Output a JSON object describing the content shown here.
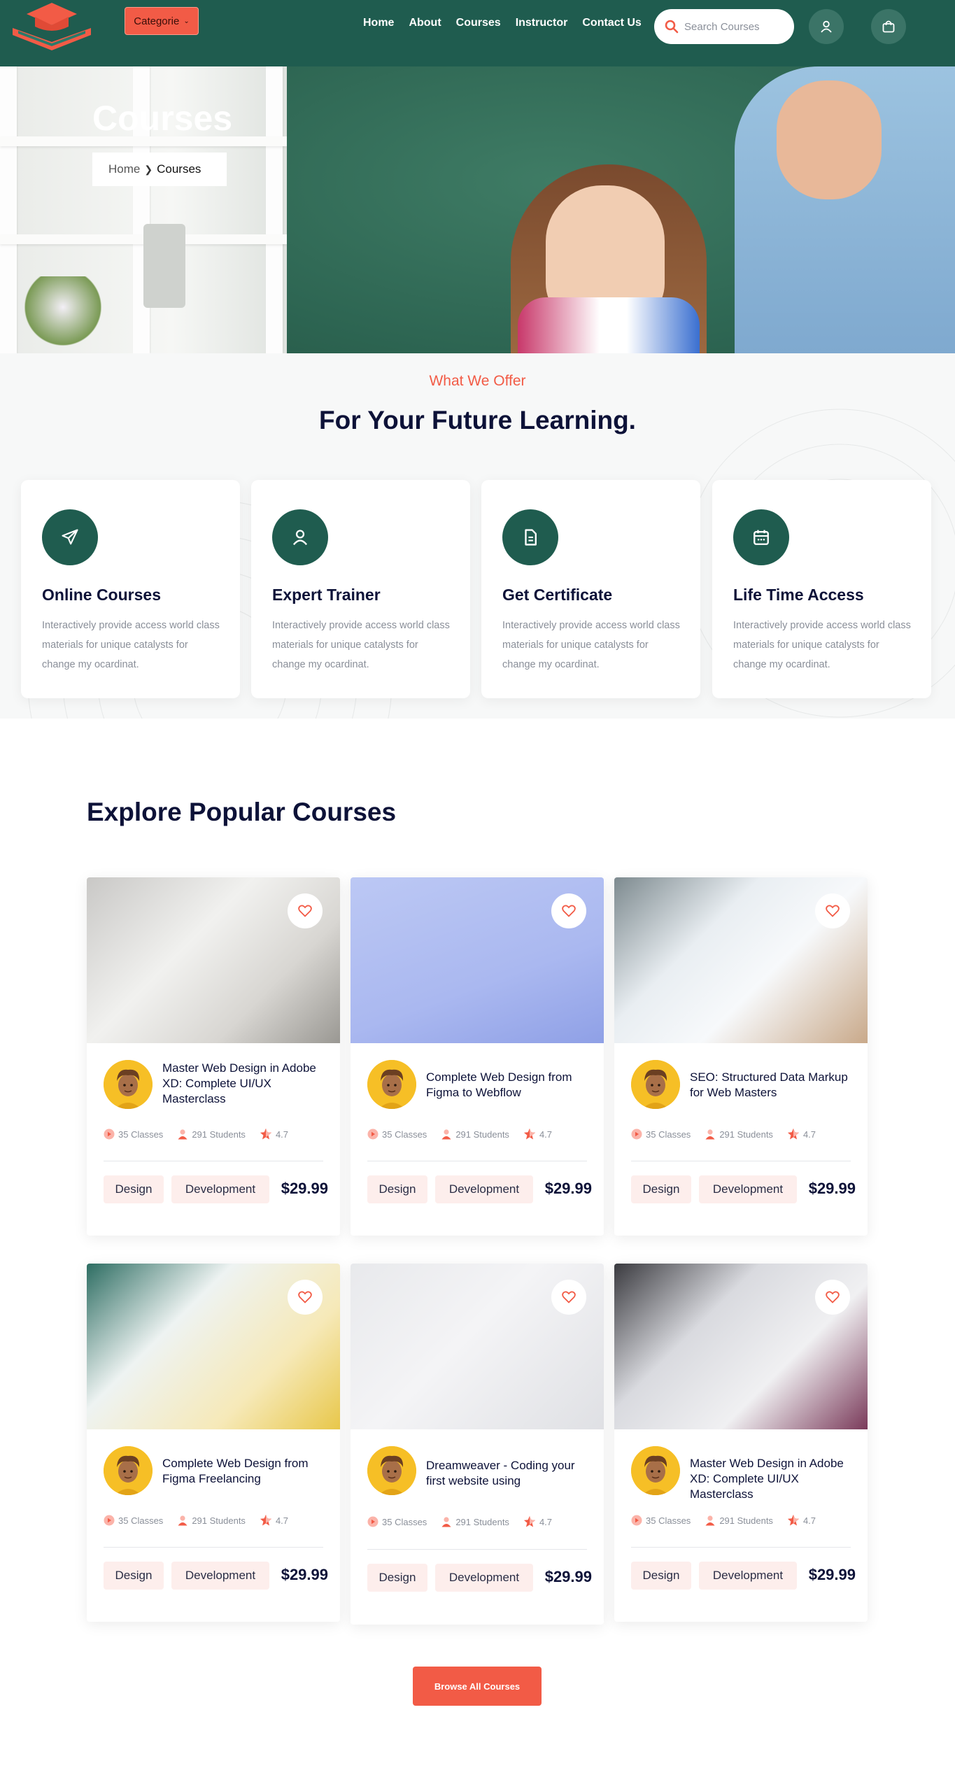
{
  "nav": {
    "category_label": "Categorie",
    "menu": [
      "Home",
      "About",
      "Courses",
      "Instructor",
      "Contact Us"
    ],
    "search_placeholder": "Search Courses"
  },
  "hero": {
    "title": "Courses",
    "breadcrumb": {
      "home": "Home",
      "current": "Courses"
    }
  },
  "offer": {
    "subtitle": "What We Offer",
    "title": "For Your Future Learning.",
    "features": [
      {
        "icon": "paper-plane-icon",
        "title": "Online Courses",
        "text": "Interactively provide access world class materials for unique catalysts for change my ocardinat."
      },
      {
        "icon": "user-icon",
        "title": "Expert Trainer",
        "text": "Interactively provide access world class materials for unique catalysts for change my ocardinat."
      },
      {
        "icon": "document-icon",
        "title": "Get Certificate",
        "text": "Interactively provide access world class materials for unique catalysts for change my ocardinat."
      },
      {
        "icon": "calendar-icon",
        "title": "Life Time Access",
        "text": "Interactively provide access world class materials for unique catalysts for change my ocardinat."
      }
    ]
  },
  "courses": {
    "title": "Explore Popular Courses",
    "items": [
      {
        "title": "Master Web Design in Adobe XD: Complete UI/UX Masterclass",
        "classes": "35 Classes",
        "students": "291 Students",
        "rating": "4.7",
        "tags": [
          "Design",
          "Development"
        ],
        "price": "$29.99"
      },
      {
        "title": "Complete Web Design from Figma to Webflow",
        "classes": "35 Classes",
        "students": "291 Students",
        "rating": "4.7",
        "tags": [
          "Design",
          "Development"
        ],
        "price": "$29.99"
      },
      {
        "title": "SEO: Structured Data Markup for Web Masters",
        "classes": "35 Classes",
        "students": "291 Students",
        "rating": "4.7",
        "tags": [
          "Design",
          "Development"
        ],
        "price": "$29.99"
      },
      {
        "title": "Complete Web Design from Figma Freelancing",
        "classes": "35 Classes",
        "students": "291 Students",
        "rating": "4.7",
        "tags": [
          "Design",
          "Development"
        ],
        "price": "$29.99"
      },
      {
        "title": "Dreamweaver - Coding your first website using",
        "classes": "35 Classes",
        "students": "291 Students",
        "rating": "4.7",
        "tags": [
          "Design",
          "Development"
        ],
        "price": "$29.99"
      },
      {
        "title": "Master Web Design in Adobe XD: Complete UI/UX Masterclass",
        "classes": "35 Classes",
        "students": "291 Students",
        "rating": "4.7",
        "tags": [
          "Design",
          "Development"
        ],
        "price": "$29.99"
      }
    ],
    "browse_label": "Browse All Courses"
  },
  "colors": {
    "primary": "#1f5c4f",
    "accent": "#f25b46",
    "heading": "#0d1238",
    "muted": "#8a8f99"
  }
}
